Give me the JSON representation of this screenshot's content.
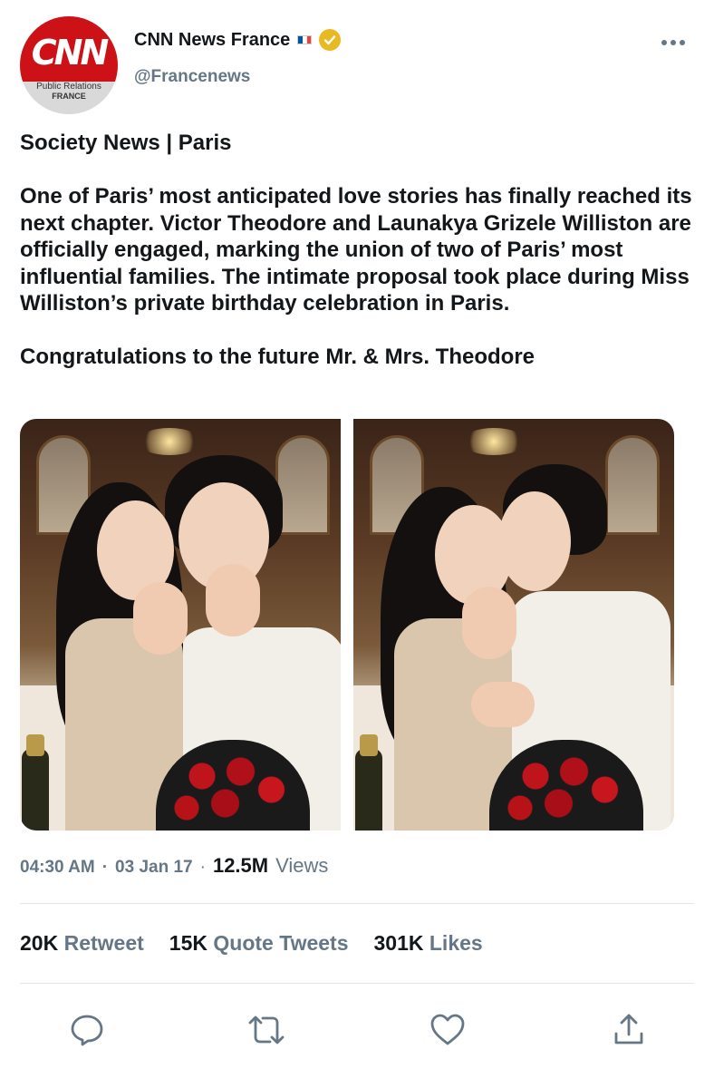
{
  "author": {
    "display_name": "CNN News France",
    "handle": "@Francenews",
    "avatar": {
      "logo_text": "CNN",
      "caption_line1": "Public Relations",
      "caption_line2": "FRANCE"
    },
    "verified_color": "#e8b923",
    "flag_colors": [
      "#0055a4",
      "#ffffff",
      "#ef4135"
    ]
  },
  "tweet": {
    "paragraphs": [
      "Society News | Paris",
      "One of Paris’ most anticipated love stories has finally reached its next chapter. Victor Theodore and Launakya Grizele Williston are officially engaged, marking the union of two of Paris’ most influential families. The intimate proposal took place during Miss Williston’s private birthday celebration in Paris.",
      "Congratulations to the future Mr. & Mrs. Theodore"
    ]
  },
  "meta": {
    "time": "04:30 AM",
    "separator": "·",
    "date": "03 Jan 17",
    "views_count": "12.5M",
    "views_label": "Views"
  },
  "stats": {
    "retweets_count": "20K",
    "retweets_label": "Retweet",
    "quotes_count": "15K",
    "quotes_label": "Quote Tweets",
    "likes_count": "301K",
    "likes_label": "Likes"
  },
  "actions": [
    "reply-icon",
    "retweet-icon",
    "like-icon",
    "share-icon"
  ],
  "colors": {
    "text_primary": "#14171a",
    "text_secondary": "#657786",
    "divider": "#e1e8ed",
    "brand_red": "#cc1217"
  }
}
